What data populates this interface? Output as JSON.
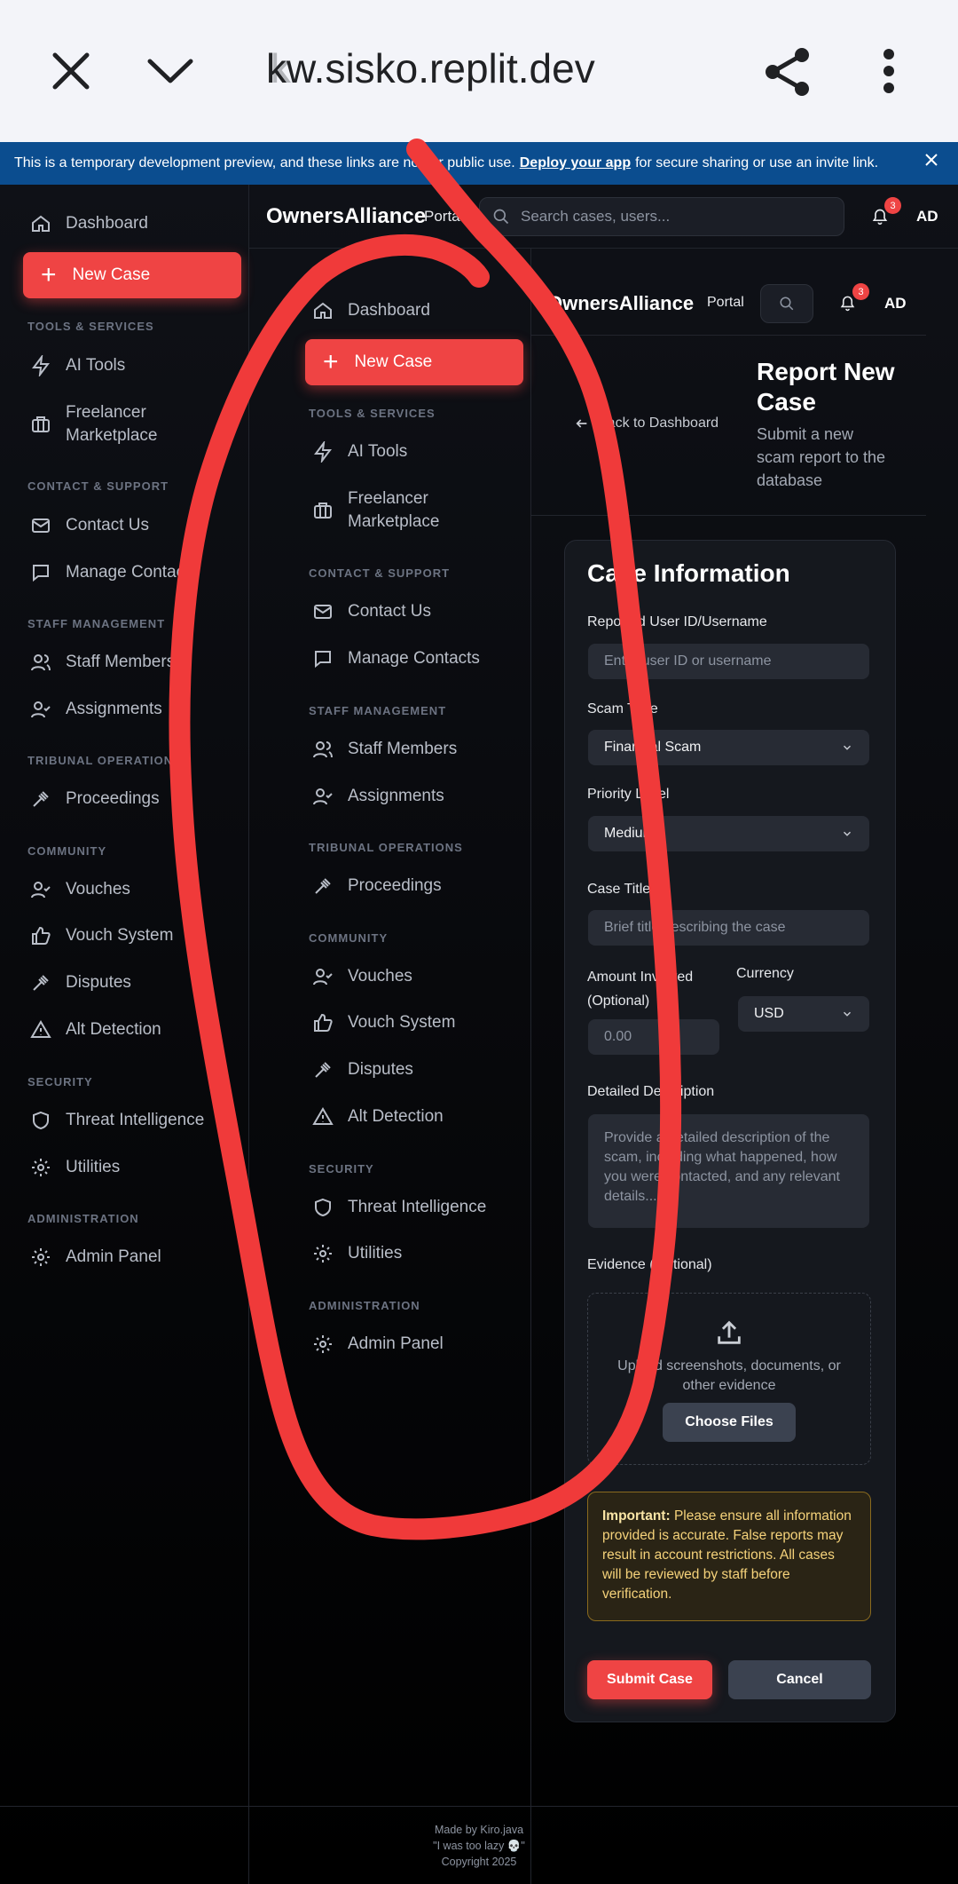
{
  "browser": {
    "url_fade": "k",
    "url": "kw.sisko.replit.dev",
    "banner_text": "This is a temporary development preview, and these links are not for public use.",
    "banner_link": "Deploy your app",
    "banner_tail": "for secure sharing or use an invite link."
  },
  "nav": {
    "dashboard": "Dashboard",
    "new_case": "New Case",
    "sec_tools": "TOOLS & SERVICES",
    "ai_tools": "AI Tools",
    "freelancer_1": "Freelancer",
    "freelancer_2": "Marketplace",
    "sec_contact": "CONTACT & SUPPORT",
    "contact_us": "Contact Us",
    "manage_contacts": "Manage Contacts",
    "sec_staff": "STAFF MANAGEMENT",
    "staff_members": "Staff Members",
    "assignments": "Assignments",
    "sec_tribunal": "TRIBUNAL OPERATIONS",
    "proceedings": "Proceedings",
    "sec_community": "COMMUNITY",
    "vouches": "Vouches",
    "vouch_system": "Vouch System",
    "disputes": "Disputes",
    "alt_detection": "Alt Detection",
    "sec_security": "SECURITY",
    "threat_intel": "Threat Intelligence",
    "utilities": "Utilities",
    "sec_admin": "ADMINISTRATION",
    "admin_panel": "Admin Panel"
  },
  "header": {
    "brand": "OwnersAlliance",
    "portal": "Portal",
    "search_placeholder": "Search cases, users...",
    "notif_count": "3",
    "avatar": "AD"
  },
  "page": {
    "back": "Back to Dashboard",
    "title_1": "Report New",
    "title_2": "Case",
    "sub_1": "Submit a new",
    "sub_2": "scam report to the",
    "sub_3": "database"
  },
  "form": {
    "title": "Case Information",
    "reported_label": "Reported User ID/Username",
    "reported_placeholder": "Enter user ID or username",
    "scam_type_label": "Scam Type",
    "scam_type_value": "Financial Scam",
    "priority_label": "Priority Level",
    "priority_value": "Medium",
    "case_title_label": "Case Title",
    "case_title_placeholder": "Brief title describing the case",
    "amount_label_1": "Amount Involved",
    "amount_label_2": "(Optional)",
    "amount_placeholder": "0.00",
    "currency_label": "Currency",
    "currency_value": "USD",
    "desc_label": "Detailed Description",
    "desc_placeholder": "Provide a detailed description of the scam, including what happened, how you were contacted, and any relevant details...",
    "evidence_label": "Evidence (Optional)",
    "upload_text": "Upload screenshots, documents, or other evidence",
    "choose_files": "Choose Files",
    "important_label": "Important:",
    "important_text": "Please ensure all information provided is accurate. False reports may result in account restrictions. All cases will be reviewed by staff before verification.",
    "submit": "Submit Case",
    "cancel": "Cancel"
  },
  "footer": {
    "line1": "Made by Kiro.java",
    "line2": "\"I was too lazy 💀\"",
    "line3": "Copyright 2025"
  },
  "colors": {
    "accent": "#ef4444",
    "banner": "#0b4d8f",
    "scribble": "#f03a3a"
  }
}
